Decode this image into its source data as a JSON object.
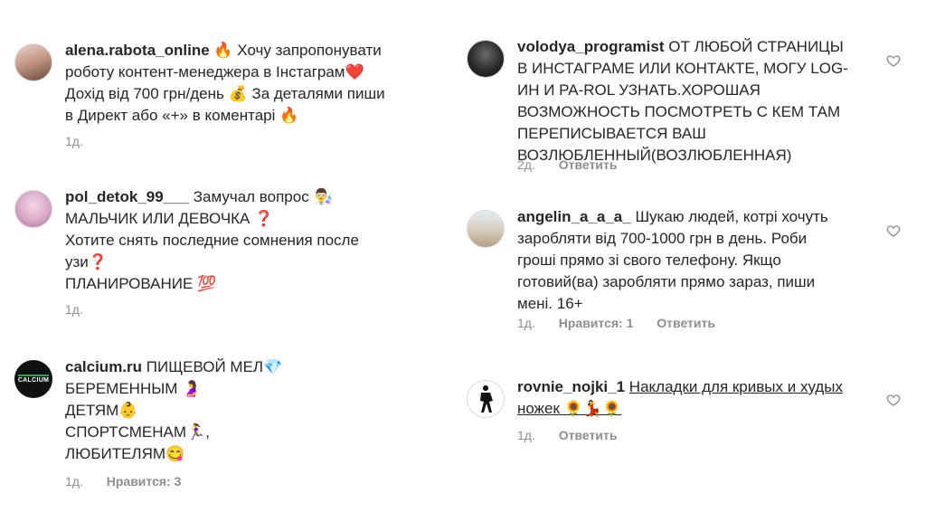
{
  "left": [
    {
      "username": "alena.rabota_online",
      "lines": [
        "🔥 Хочу запропонувати",
        "роботу контент-менеджера в Інстаграм❤️",
        "Дохід від 700 грн/день 💰 За деталями пиши",
        "в Директ або «+» в коментарі 🔥"
      ],
      "time": "1д."
    },
    {
      "username": "pol_detok_99___",
      "lines": [
        "Замучал вопрос 👨‍🔬",
        "МАЛЬЧИК ИЛИ ДЕВОЧКА ❓",
        "Хотите снять последние сомнения после",
        "узи❓",
        "ПЛАНИРОВАНИЕ 💯"
      ],
      "time": "1д."
    },
    {
      "username": "calcium.ru",
      "lines": [
        "ПИЩЕВОЙ МЕЛ💎",
        "БЕРЕМЕННЫМ 🤰",
        "ДЕТЯМ👶",
        "СПОРТСМЕНАМ🏃‍♀️,",
        "ЛЮБИТЕЛЯМ😋"
      ],
      "time": "1д.",
      "likes": "Нравится: 3",
      "avatar_text": "CALCIUM"
    }
  ],
  "right": [
    {
      "username": "volodya_programist",
      "lines": [
        "ОТ ЛЮБОЙ СТРАНИЦЫ",
        "В ИНСТАГРАМЕ ИЛИ КОНТАКТЕ, МОГУ LOG-",
        "ИН И PA-ROL УЗНАТЬ.ХОРОШАЯ",
        "ВОЗМОЖНОСТЬ ПОСМОТРЕТЬ С КЕМ ТАМ",
        "ПЕРЕПИСЫВАЕТСЯ ВАШ",
        "ВОЗЛЮБЛЕННЫЙ(ВОЗЛЮБЛЕННАЯ)"
      ],
      "time": "2д.",
      "reply": "Ответить"
    },
    {
      "username": "angelin_a_a_a_",
      "lines": [
        "Шукаю людей, котрі хочуть",
        "заробляти від 700-1000 грн в день. Роби",
        "гроші прямо зі свого телефону. Якщо",
        "готовий(ва) заробляти прямо зараз, пиши",
        "мені. 16+"
      ],
      "time": "1д.",
      "likes": "Нравится: 1",
      "reply": "Ответить"
    },
    {
      "username": "rovnie_nojki_1",
      "lines": [
        "Накладки для кривых и худых",
        "ножек 🌻💃🌻"
      ],
      "time": "1д.",
      "reply": "Ответить"
    }
  ]
}
